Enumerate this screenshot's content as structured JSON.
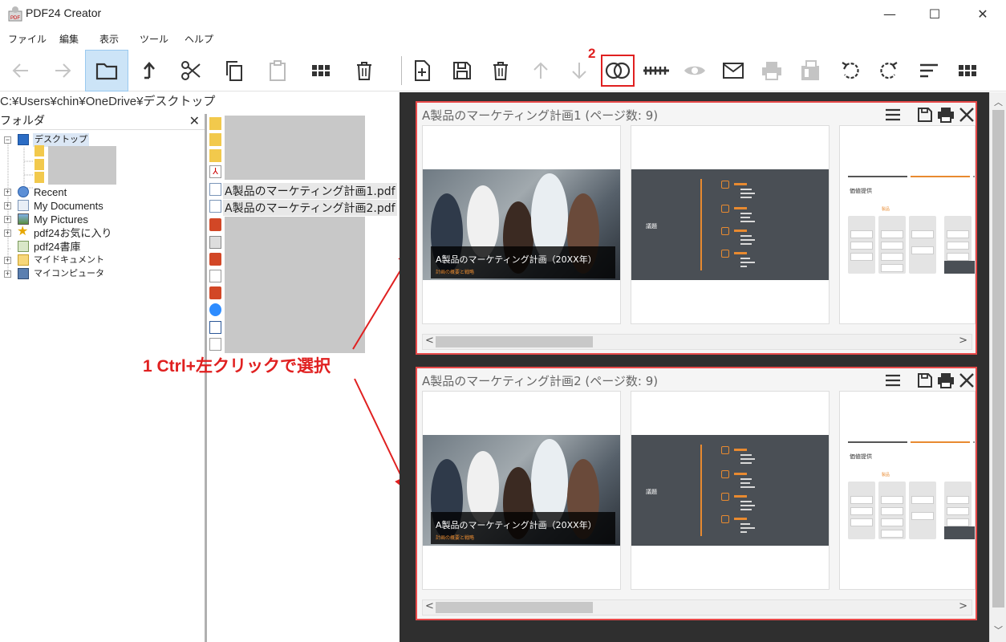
{
  "app": {
    "title": "PDF24 Creator"
  },
  "window_controls": {
    "minimize": "—",
    "maximize": "☐",
    "close": "✕"
  },
  "menu": [
    "ファイル",
    "編集",
    "表示",
    "ツール",
    "ヘルプ"
  ],
  "path": "C:¥Users¥chin¥OneDrive¥デスクトップ",
  "folder_panel": {
    "header": "フォルダ",
    "close": "✕",
    "tree": [
      {
        "label": "デスクトップ",
        "expander": "−",
        "selected": true
      },
      {
        "label": "Recent",
        "expander": "+"
      },
      {
        "label": "My Documents",
        "expander": "+"
      },
      {
        "label": "My Pictures",
        "expander": "+"
      },
      {
        "label": "pdf24お気に入り",
        "expander": "+"
      },
      {
        "label": "pdf24書庫",
        "expander": ""
      },
      {
        "label": "マイドキュメント",
        "expander": "+"
      },
      {
        "label": "マイコンピュータ",
        "expander": "+"
      }
    ]
  },
  "files": {
    "items": [
      "A製品のマーケティング計画1.pdf",
      "A製品のマーケティング計画2.pdf"
    ]
  },
  "documents": [
    {
      "title": "A製品のマーケティング計画1 (ページ数: 9)",
      "slide1_title": "A製品のマーケティング計画（20XX年）",
      "slide1_sub": "計画の概要と戦略",
      "slide2_label": "議題",
      "slide3_title": "価値提供",
      "slide3_tag": "製品",
      "scroll_left": "<",
      "scroll_right": ">"
    },
    {
      "title": "A製品のマーケティング計画2 (ページ数: 9)",
      "slide1_title": "A製品のマーケティング計画（20XX年）",
      "slide1_sub": "計画の概要と戦略",
      "slide2_label": "議題",
      "slide3_title": "価値提供",
      "slide3_tag": "製品",
      "scroll_left": "<",
      "scroll_right": ">"
    }
  ],
  "annotations": {
    "step1": "1 Ctrl+左クリックで選択",
    "step2": "2"
  },
  "colors": {
    "accent": "#e02020",
    "highlight": "#cce4f7",
    "orange": "#e88a30"
  }
}
